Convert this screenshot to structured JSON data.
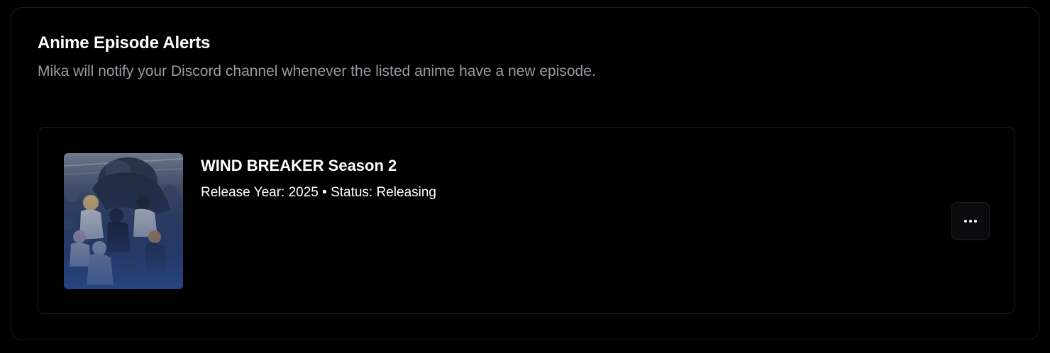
{
  "section": {
    "title": "Anime Episode Alerts",
    "subtitle": "Mika will notify your Discord channel whenever the listed anime have a new episode."
  },
  "anime_list": [
    {
      "title": "WIND BREAKER Season 2",
      "meta": "Release Year: 2025 • Status: Releasing",
      "cover_icon": "anime-cover-image",
      "menu_icon": "more-horizontal-icon"
    }
  ],
  "colors": {
    "background": "#000000",
    "border": "#1c1c1f",
    "subtitle": "#9a9aa2",
    "button_bg": "#0b0b0d"
  }
}
